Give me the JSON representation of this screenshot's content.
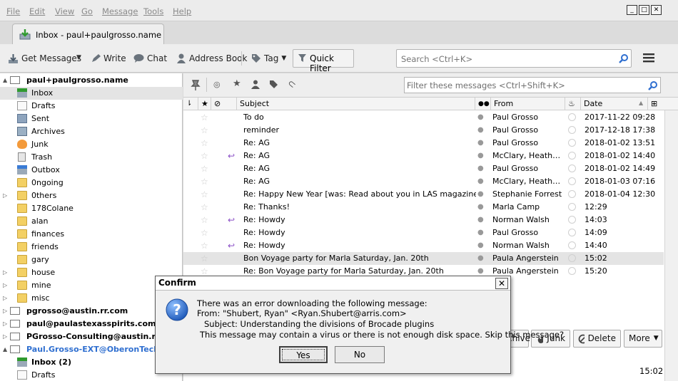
{
  "menubar": {
    "file": "File",
    "edit": "Edit",
    "view": "View",
    "go": "Go",
    "message": "Message",
    "tools": "Tools",
    "help": "Help"
  },
  "tab": {
    "label": "Inbox - paul+paulgrosso.name"
  },
  "toolbar": {
    "get_messages": "Get Messages",
    "write": "Write",
    "chat": "Chat",
    "address_book": "Address Book",
    "tag": "Tag",
    "quick_filter": "Quick Filter",
    "search_placeholder": "Search <Ctrl+K>"
  },
  "folders": [
    {
      "label": "paul+paulgrosso.name",
      "type": "account",
      "twist": "▲"
    },
    {
      "label": "Inbox",
      "type": "inbox",
      "selected": true
    },
    {
      "label": "Drafts",
      "type": "drafts"
    },
    {
      "label": "Sent",
      "type": "sent"
    },
    {
      "label": "Archives",
      "type": "archives"
    },
    {
      "label": "Junk",
      "type": "junk"
    },
    {
      "label": "Trash",
      "type": "trash"
    },
    {
      "label": "Outbox",
      "type": "outbox"
    },
    {
      "label": "0ngoing",
      "type": "folder"
    },
    {
      "label": "0thers",
      "type": "folder",
      "twist": "▷"
    },
    {
      "label": "178Colane",
      "type": "folder"
    },
    {
      "label": "alan",
      "type": "folder"
    },
    {
      "label": "finances",
      "type": "folder"
    },
    {
      "label": "friends",
      "type": "folder"
    },
    {
      "label": "gary",
      "type": "folder"
    },
    {
      "label": "house",
      "type": "folder",
      "twist": "▷"
    },
    {
      "label": "mine",
      "type": "folder",
      "twist": "▷"
    },
    {
      "label": "misc",
      "type": "folder",
      "twist": "▷"
    },
    {
      "label": "pgrosso@austin.rr.com",
      "type": "account2",
      "twist": "▷"
    },
    {
      "label": "paul@paulastexasspirits.com",
      "type": "account2",
      "twist": "▷"
    },
    {
      "label": "PGrosso-Consulting@austin.rr.com",
      "type": "account2",
      "twist": "▷"
    },
    {
      "label": "Paul.Grosso-EXT@OberonTech.com",
      "type": "account3",
      "twist": "▲"
    },
    {
      "label": "Inbox (2)",
      "type": "inbox2"
    },
    {
      "label": "Drafts",
      "type": "drafts"
    }
  ],
  "quickfilter": {
    "placeholder": "Filter these messages <Ctrl+Shift+K>"
  },
  "columns": {
    "subject": "Subject",
    "from": "From",
    "date": "Date"
  },
  "messages": [
    {
      "subject": "To do",
      "from": "Paul Grosso",
      "date": "2017-11-22 09:28",
      "reply": false
    },
    {
      "subject": "reminder",
      "from": "Paul Grosso",
      "date": "2017-12-18 17:38",
      "reply": false
    },
    {
      "subject": "Re: AG",
      "from": "Paul Grosso",
      "date": "2018-01-02 13:51",
      "reply": false
    },
    {
      "subject": "Re: AG",
      "from": "McClary, Heather ...",
      "date": "2018-01-02 14:40",
      "reply": true
    },
    {
      "subject": "Re: AG",
      "from": "Paul Grosso",
      "date": "2018-01-02 14:49",
      "reply": false
    },
    {
      "subject": "Re: AG",
      "from": "McClary, Heather ...",
      "date": "2018-01-03 07:16",
      "reply": false
    },
    {
      "subject": "Re: Happy New Year [was: Read about you in LAS magazine]",
      "from": "Stephanie Forrest",
      "date": "2018-01-04 12:30",
      "reply": false
    },
    {
      "subject": "Re: Thanks!",
      "from": "Marla Camp",
      "date": "12:29",
      "reply": false
    },
    {
      "subject": "Re: Howdy",
      "from": "Norman Walsh",
      "date": "14:03",
      "reply": true
    },
    {
      "subject": "Re: Howdy",
      "from": "Paul Grosso",
      "date": "14:09",
      "reply": false
    },
    {
      "subject": "Re: Howdy",
      "from": "Norman Walsh",
      "date": "14:40",
      "reply": true
    },
    {
      "subject": "Bon Voyage party for Marla Saturday, Jan. 20th",
      "from": "Paula Angerstein",
      "date": "15:02",
      "reply": false,
      "selected": true
    },
    {
      "subject": "Re: Bon Voyage party for Marla Saturday, Jan. 20th",
      "from": "Paula Angerstein",
      "date": "15:20",
      "reply": false
    }
  ],
  "actions": {
    "archive": "chive",
    "junk": "Junk",
    "delete": "Delete",
    "more": "More"
  },
  "status": {
    "clock": "15:02"
  },
  "dialog": {
    "title": "Confirm",
    "line1": "There was an error downloading the following message:",
    "line2": "From: \"Shubert, Ryan\" <Ryan.Shubert@arris.com>",
    "line3": "Subject: Understanding the divisions of Brocade plugins",
    "line4": "This message may contain a virus or there is not enough disk space. Skip this message?",
    "yes": "Yes",
    "no": "No"
  },
  "colors": {
    "accent": "#2f6fd0",
    "folder": "#f3d064",
    "reply": "#8a4fc6",
    "selected_row": "#e4e4e4"
  }
}
